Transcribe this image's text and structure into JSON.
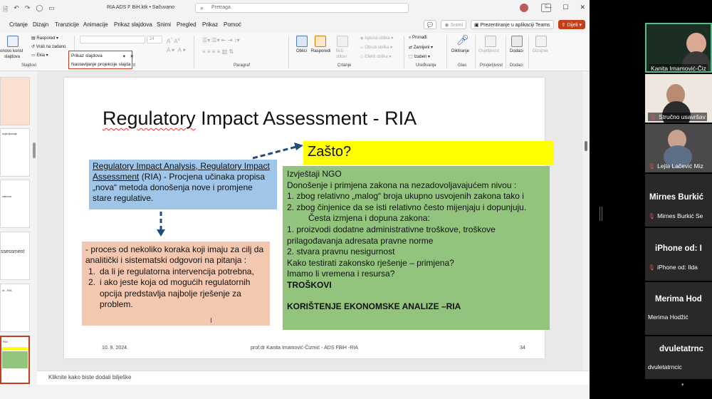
{
  "titlebar": {
    "doc_title": "RIA ADS F BiH.ktk • Sačuvano",
    "search_placeholder": "Pretraga"
  },
  "tabs": [
    "Crtanje",
    "Dizajn",
    "Tranzicije",
    "Animacije",
    "Prikaz slajdova",
    "Snimi",
    "Pregled",
    "Prikaz",
    "Pomoć"
  ],
  "tab_buttons": {
    "snimi": "Snimi",
    "teams": "Prezentiranje u aplikaciji Teams",
    "share": "Dijeli"
  },
  "ribbon": {
    "slides_new_line1": "onovo korist",
    "slides_new_line2": "slajdova",
    "layout": "Raspored",
    "reset": "Vrati na zadano",
    "section": "Ekia",
    "group_slides": "Slajdovi",
    "group_font_suffix": "nt",
    "group_paragraph": "Paragraf",
    "font_size": "24",
    "shapes": "Oblici",
    "arrange": "Rasporedi",
    "quick_styles_line1": "Brzi",
    "quick_styles_line2": "stilovi",
    "fill": "Ispuna oblika",
    "outline": "Obrub oblika",
    "effects": "Efekti oblika",
    "group_drawing": "Crtanje",
    "find": "Pronađi",
    "replace": "Zamijeni",
    "select": "Izaberi",
    "group_editing": "Uređivanje",
    "dictate": "Diktiranje",
    "group_voice": "Glas",
    "sensitivity": "Osjetljivost",
    "group_confidential": "Povjerljivost",
    "addins": "Dodaci",
    "group_addins": "Dodaci",
    "designer": "Dizajner"
  },
  "dropdown": {
    "title": "Prikaz slajdova",
    "tooltip": "Nastavljanje projekcije slajda"
  },
  "thumbnails": {
    "t2": "ocjenjivanje",
    "t3": "zakona",
    "t4": "ssessment",
    "t5": "nt - RIA",
    "t6": "RIA"
  },
  "slide": {
    "title_underlined": "Regulatory",
    "title_rest": " Impact Assessment - RIA",
    "blue_underlined": "Regulatory Impact Analysis, Regulatory Impact Assessment",
    "blue_rest": " (RIA) - Procjena učinaka propisa „nova“ metoda donošenja nove i promjene stare regulative.",
    "yellow": "Zašto?",
    "green": {
      "l1": "Izvještaji NGO",
      "l2": "Donošenje i primjena zakona na nezadovoljavajućem nivou :",
      "l3": "1. zbog relativno „malog“ broja ukupno usvojenih zakona tako i",
      "l4": "2. zbog činjenice da se isti relativno često mijenjaju i dopunjuju.",
      "l5": "Česta izmjena i dopuna zakona:",
      "l6": "1. proizvodi dodatne administrativne troškove, troškove prilagođavanja adresata pravne norme",
      "l7": "2. stvara pravnu nesigurnost",
      "l8": "Kako testirati zakonsko rješenje – primjena?",
      "l9": "Imamo li vremena i resursa?",
      "l10": "TROŠKOVI",
      "l11": "KORIŠTENJE EKONOMSKE ANALIZE –RIA"
    },
    "orange": {
      "intro": "- proces od nekoliko koraka koji imaju za cilj da analitički i sistematski odgovori na pitanja :",
      "n1": "1.",
      "i1": "da li je regulatorna intervencija potrebna,",
      "n2": "2.",
      "i2": "i ako jeste koja od mogućih regulatornih opcija predstavlja najbolje rješenje za problem."
    },
    "footer_date": "10. 9. 2024.",
    "footer_center": "prof.dr Kanita Imamović-Čizmić - ADS FBiH -RIA",
    "footer_num": "34"
  },
  "notes_placeholder": "Kliknite kako biste dodali bilješke",
  "teams": {
    "p1": "Kanita Imamović-Čiz",
    "p2": "Stručno usavršav",
    "p3": "Lejla Lačević Miz",
    "p4_big": "Mirnes Burkić",
    "p4": "Mirnes Burkić Se",
    "p5_big": "iPhone od: I",
    "p5": "iPhone od: Ilda",
    "p6_big": "Merima Hod",
    "p6": "Merima Hodžić",
    "p7_big": "dvuletatrnc",
    "p7": "dvuletatrncic"
  },
  "colors": {
    "brand_red": "#c43e1c",
    "blue_box": "#9fc5e8",
    "green_box": "#93c47d",
    "orange_box": "#f4c7b0",
    "yellow_box": "#ffff00",
    "arrow": "#1f4e79"
  }
}
